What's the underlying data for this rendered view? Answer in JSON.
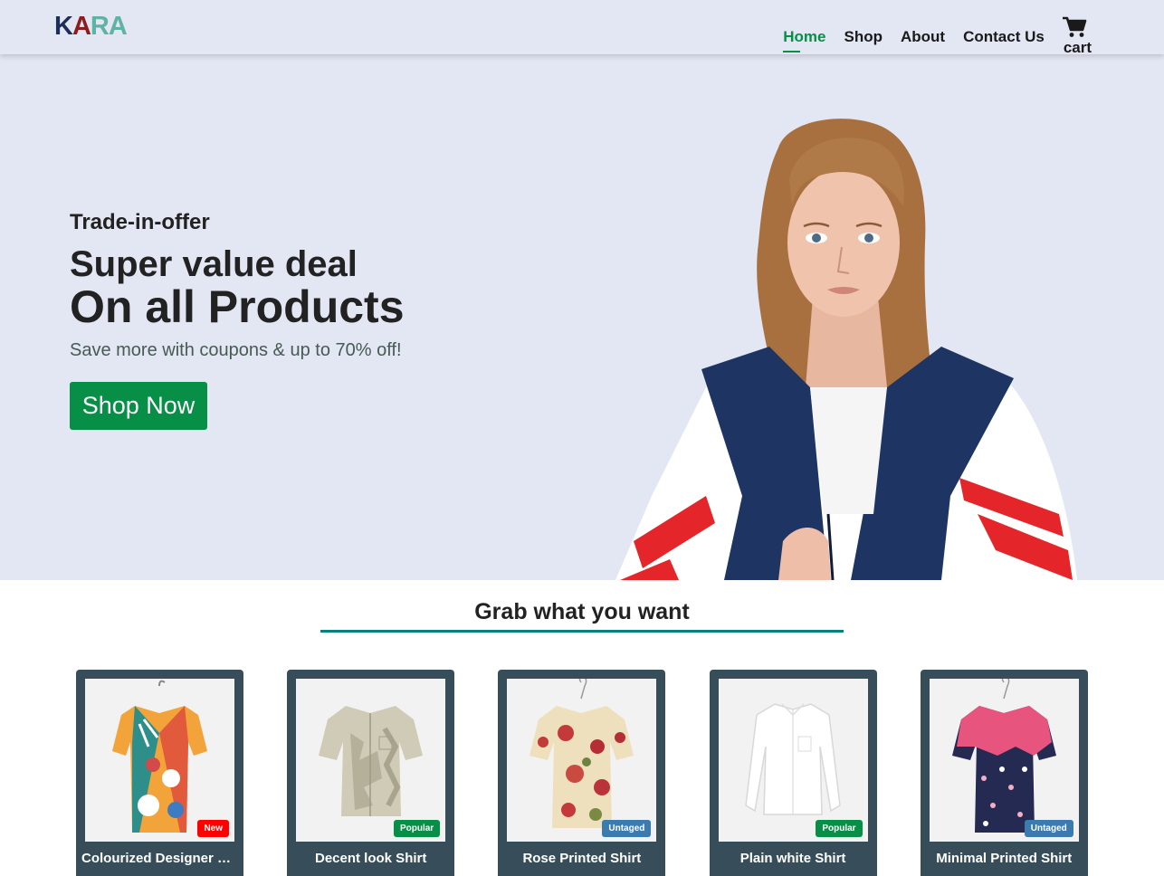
{
  "header": {
    "logo": {
      "l1": "K",
      "l2": "A",
      "l3": "R",
      "l4": "A"
    },
    "nav": [
      {
        "label": "Home",
        "active": true
      },
      {
        "label": "Shop",
        "active": false
      },
      {
        "label": "About",
        "active": false
      },
      {
        "label": "Contact Us",
        "active": false
      }
    ],
    "cart_label": "cart",
    "cart_icon": "cart-icon"
  },
  "hero": {
    "eyebrow": "Trade-in-offer",
    "headline_1": "Super value deal",
    "headline_2": "On all Products",
    "subtext": "Save more with coupons & up to 70% off!",
    "cta_label": "Shop Now",
    "image": "model-in-jacket"
  },
  "section": {
    "title": "Grab what you want"
  },
  "products": [
    {
      "name": "Colourized Designer Shirt",
      "badge": "New",
      "badge_color": "#ff0000",
      "image": "colourful-print-shirt"
    },
    {
      "name": "Decent look Shirt",
      "badge": "Popular",
      "badge_color": "#088f47",
      "image": "beige-print-shirt"
    },
    {
      "name": "Rose Printed Shirt",
      "badge": "Untaged",
      "badge_color": "#3c7bb0",
      "image": "rose-print-shirt"
    },
    {
      "name": "Plain white Shirt",
      "badge": "Popular",
      "badge_color": "#088f47",
      "image": "white-shirt"
    },
    {
      "name": "Minimal Printed Shirt",
      "badge": "Untaged",
      "badge_color": "#3c7bb0",
      "image": "navy-floral-shirt"
    }
  ],
  "colors": {
    "accent": "#088f47",
    "header_bg": "#e3e6f3",
    "card_bg": "#374d5a"
  }
}
